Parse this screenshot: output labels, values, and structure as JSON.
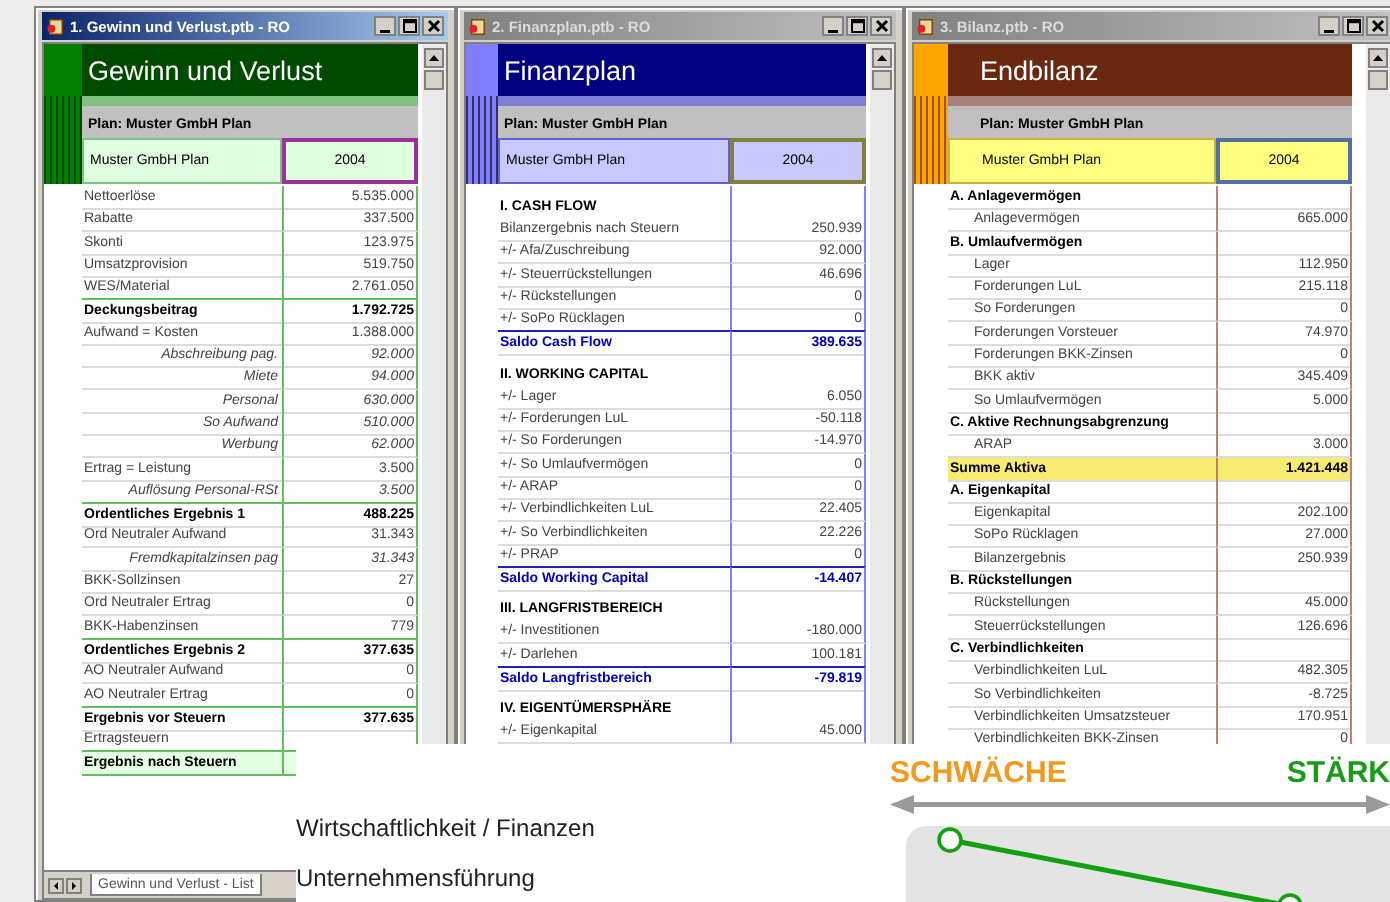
{
  "windows": [
    {
      "title": "1. Gewinn und Verlust.ptb - RO",
      "active": true,
      "heading": "Gewinn und Verlust",
      "plan": "Plan: Muster GmbH Plan",
      "plan_name": "Muster GmbH Plan",
      "year": "2004",
      "sheet_tab": "Gewinn und Verlust - List",
      "rows": [
        {
          "kind": "item",
          "label": "Nettoerlöse",
          "value": "5.535.000"
        },
        {
          "kind": "item",
          "label": "Rabatte",
          "value": "337.500"
        },
        {
          "kind": "item",
          "label": "Skonti",
          "value": "123.975"
        },
        {
          "kind": "item",
          "label": "Umsatzprovision",
          "value": "519.750"
        },
        {
          "kind": "item",
          "label": "WES/Material",
          "value": "2.761.050"
        },
        {
          "kind": "total",
          "label": "Deckungsbeitrag",
          "value": "1.792.725"
        },
        {
          "kind": "item",
          "label": "Aufwand = Kosten",
          "value": "1.388.000"
        },
        {
          "kind": "sub",
          "label": "Abschreibung pag.",
          "value": "92.000"
        },
        {
          "kind": "sub",
          "label": "Miete",
          "value": "94.000"
        },
        {
          "kind": "sub",
          "label": "Personal",
          "value": "630.000"
        },
        {
          "kind": "sub",
          "label": "So Aufwand",
          "value": "510.000"
        },
        {
          "kind": "sub",
          "label": "Werbung",
          "value": "62.000"
        },
        {
          "kind": "item",
          "label": "Ertrag = Leistung",
          "value": "3.500"
        },
        {
          "kind": "sub",
          "label": "Auflösung Personal-RSt",
          "value": "3.500"
        },
        {
          "kind": "total",
          "label": "Ordentliches Ergebnis 1",
          "value": "488.225"
        },
        {
          "kind": "item",
          "label": "Ord Neutraler Aufwand",
          "value": "31.343"
        },
        {
          "kind": "sub",
          "label": "Fremdkapitalzinsen pag",
          "value": "31.343"
        },
        {
          "kind": "item",
          "label": "BKK-Sollzinsen",
          "value": "27"
        },
        {
          "kind": "item",
          "label": "Ord Neutraler Ertrag",
          "value": "0"
        },
        {
          "kind": "item",
          "label": "BKK-Habenzinsen",
          "value": "779"
        },
        {
          "kind": "total",
          "label": "Ordentliches Ergebnis 2",
          "value": "377.635"
        },
        {
          "kind": "item",
          "label": "AO Neutraler Aufwand",
          "value": "0"
        },
        {
          "kind": "item",
          "label": "AO Neutraler Ertrag",
          "value": "0"
        },
        {
          "kind": "total",
          "label": "Ergebnis vor Steuern",
          "value": "377.635"
        },
        {
          "kind": "item",
          "label": "Ertragsteuern"
        },
        {
          "kind": "result",
          "label": "Ergebnis nach Steuern"
        }
      ]
    },
    {
      "title": "2. Finanzplan.ptb - RO",
      "active": false,
      "heading": "Finanzplan",
      "plan": "Plan: Muster GmbH Plan",
      "plan_name": "Muster GmbH Plan",
      "year": "2004",
      "rows": [
        {
          "kind": "heading",
          "label": "I. CASH FLOW"
        },
        {
          "kind": "item",
          "label": "Bilanzergebnis nach Steuern",
          "value": "250.939"
        },
        {
          "kind": "item",
          "label": "+/- Afa/Zuschreibung",
          "value": "92.000"
        },
        {
          "kind": "item",
          "label": "+/- Steuerrückstellungen",
          "value": "46.696"
        },
        {
          "kind": "item",
          "label": "+/- Rückstellungen",
          "value": "0"
        },
        {
          "kind": "item",
          "label": "+/- SoPo Rücklagen",
          "value": "0"
        },
        {
          "kind": "saldo",
          "label": "Saldo Cash Flow",
          "value": "389.635"
        },
        {
          "kind": "heading",
          "label": "II. WORKING CAPITAL"
        },
        {
          "kind": "item",
          "label": "+/- Lager",
          "value": "6.050"
        },
        {
          "kind": "item",
          "label": "+/- Forderungen LuL",
          "value": "-50.118"
        },
        {
          "kind": "item",
          "label": "+/- So Forderungen",
          "value": "-14.970"
        },
        {
          "kind": "item",
          "label": "+/- So Umlaufvermögen",
          "value": "0"
        },
        {
          "kind": "item",
          "label": "+/- ARAP",
          "value": "0"
        },
        {
          "kind": "item",
          "label": "+/- Verbindlichkeiten LuL",
          "value": "22.405"
        },
        {
          "kind": "item",
          "label": "+/- So Verbindlichkeiten",
          "value": "22.226"
        },
        {
          "kind": "item",
          "label": "+/- PRAP",
          "value": "0"
        },
        {
          "kind": "saldo",
          "label": "Saldo Working Capital",
          "value": "-14.407"
        },
        {
          "kind": "heading",
          "label": "III. LANGFRISTBEREICH"
        },
        {
          "kind": "item",
          "label": "+/- Investitionen",
          "value": "-180.000"
        },
        {
          "kind": "item",
          "label": "+/- Darlehen",
          "value": "100.181"
        },
        {
          "kind": "saldo",
          "label": "Saldo Langfristbereich",
          "value": "-79.819"
        },
        {
          "kind": "heading",
          "label": "IV. EIGENTÜMERSPHÄRE"
        },
        {
          "kind": "item",
          "label": "+/- Eigenkapital",
          "value": "45.000"
        }
      ]
    },
    {
      "title": "3. Bilanz.ptb - RO",
      "active": false,
      "heading": "Endbilanz",
      "plan": "Plan: Muster GmbH Plan",
      "plan_name": "Muster GmbH Plan",
      "year": "2004",
      "rows": [
        {
          "kind": "section",
          "label": "A. Anlagevermögen"
        },
        {
          "kind": "item",
          "label": "Anlagevermögen",
          "value": "665.000"
        },
        {
          "kind": "section",
          "label": "B. Umlaufvermögen"
        },
        {
          "kind": "item",
          "label": "Lager",
          "value": "112.950"
        },
        {
          "kind": "item",
          "label": "Forderungen LuL",
          "value": "215.118"
        },
        {
          "kind": "item",
          "label": "So Forderungen",
          "value": "0"
        },
        {
          "kind": "item",
          "label": "Forderungen Vorsteuer",
          "value": "74.970"
        },
        {
          "kind": "item",
          "label": "Forderungen BKK-Zinsen",
          "value": "0"
        },
        {
          "kind": "item",
          "label": "BKK aktiv",
          "value": "345.409"
        },
        {
          "kind": "item",
          "label": "So Umlaufvermögen",
          "value": "5.000"
        },
        {
          "kind": "section",
          "label": "C. Aktive Rechnungsabgrenzung"
        },
        {
          "kind": "item",
          "label": "ARAP",
          "value": "3.000"
        },
        {
          "kind": "sum",
          "label": "Summe Aktiva",
          "value": "1.421.448"
        },
        {
          "kind": "section",
          "label": "A. Eigenkapital"
        },
        {
          "kind": "item",
          "label": "Eigenkapital",
          "value": "202.100"
        },
        {
          "kind": "item",
          "label": "SoPo Rücklagen",
          "value": "27.000"
        },
        {
          "kind": "item",
          "label": "Bilanzergebnis",
          "value": "250.939"
        },
        {
          "kind": "section",
          "label": "B. Rückstellungen"
        },
        {
          "kind": "item",
          "label": "Rückstellungen",
          "value": "45.000"
        },
        {
          "kind": "item",
          "label": "Steuerrückstellungen",
          "value": "126.696"
        },
        {
          "kind": "section",
          "label": "C. Verbindlichkeiten"
        },
        {
          "kind": "item",
          "label": "Verbindlichkeiten LuL",
          "value": "482.305"
        },
        {
          "kind": "item",
          "label": "So Verbindlichkeiten",
          "value": "-8.725"
        },
        {
          "kind": "item",
          "label": "Verbindlichkeiten Umsatzsteuer",
          "value": "170.951"
        },
        {
          "kind": "item",
          "label": "Verbindlichkeiten BKK-Zinsen",
          "value": "0"
        }
      ]
    }
  ],
  "overlay": {
    "lines": [
      "Wirtschaftlichkeit / Finanzen",
      "Unternehmensführung"
    ],
    "weak_label": "SCHWÄCHE",
    "strong_label": "STÄRK"
  }
}
